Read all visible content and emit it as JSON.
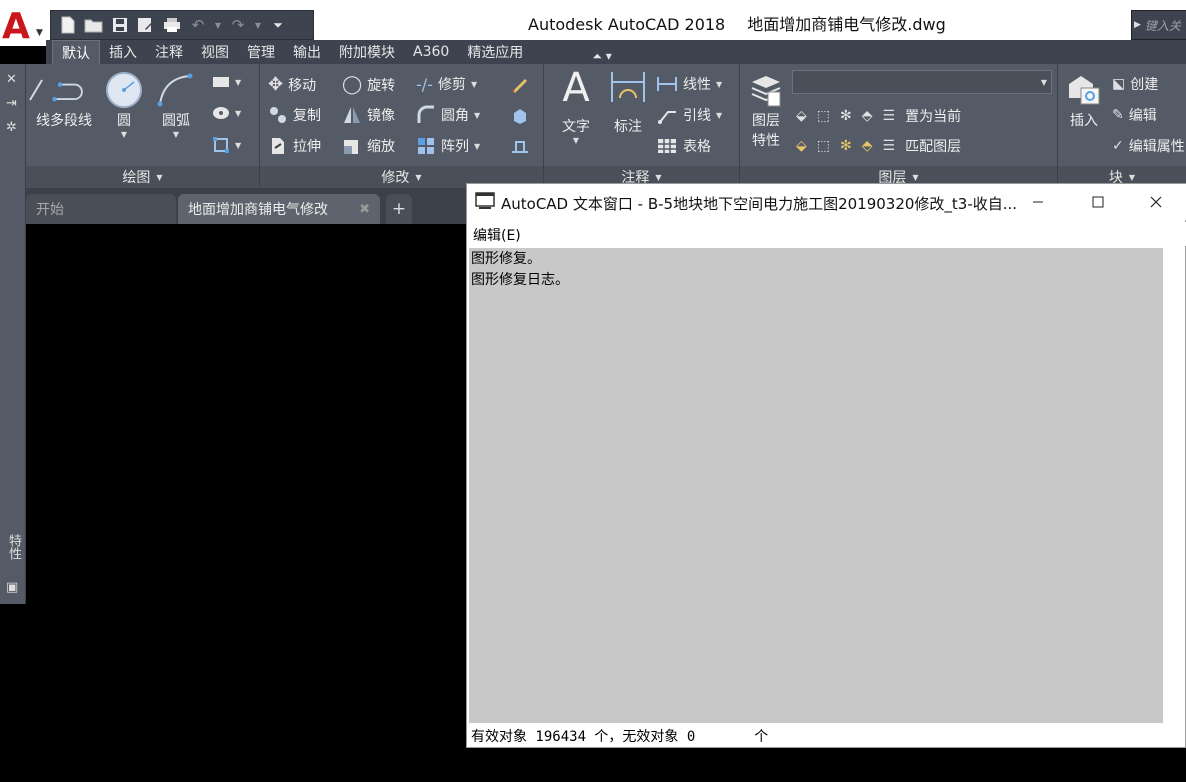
{
  "window": {
    "app_title": "Autodesk AutoCAD 2018",
    "file_title": "地面增加商铺电气修改.dwg",
    "search_placeholder": "键入关"
  },
  "app_button": {
    "logo": "A"
  },
  "quick_access": {
    "icons": [
      "new-icon",
      "open-icon",
      "save-icon",
      "save-as-icon",
      "print-icon",
      "undo-icon",
      "redo-icon",
      "customize-icon"
    ]
  },
  "ribbon_tabs": [
    "默认",
    "插入",
    "注释",
    "视图",
    "管理",
    "输出",
    "附加模块",
    "A360",
    "精选应用"
  ],
  "ribbon": {
    "draw": {
      "label": "绘图",
      "line_partial": "线",
      "polyline": "多段线",
      "circle": "圆",
      "arc": "圆弧"
    },
    "modify": {
      "label": "修改",
      "move": "移动",
      "rotate": "旋转",
      "trim": "修剪",
      "copy": "复制",
      "mirror": "镜像",
      "fillet": "圆角",
      "stretch": "拉伸",
      "scale": "缩放",
      "array": "阵列"
    },
    "annotation": {
      "label": "注释",
      "text": "文字",
      "dimension": "标注",
      "linear": "线性",
      "leader": "引线",
      "table": "表格"
    },
    "layers": {
      "label": "图层",
      "layer_properties_line1": "图层",
      "layer_properties_line2": "特性",
      "set_current": "置为当前",
      "match_layer": "匹配图层",
      "layer_dropdown_value": ""
    },
    "block": {
      "label": "块",
      "insert": "插入",
      "create": "创建",
      "edit": "编辑",
      "edit_attributes": "编辑属性"
    }
  },
  "left_strip": {
    "properties_label": "特性"
  },
  "file_tabs": {
    "start": "开始",
    "drawing": "地面增加商铺电气修改",
    "close_glyph": "✖",
    "add_glyph": "+"
  },
  "text_window": {
    "title": "AutoCAD 文本窗口 - B-5地块地下空间电力施工图20190320修改_t3-收自...",
    "menu_edit": "编辑(E)",
    "history": [
      "图形修复。",
      "图形修复日志。"
    ],
    "command_line": "有效对象 196434 个，无效对象 0       个"
  },
  "colors": {
    "titlebar_bg": "#ffffff",
    "ribbon_bg": "#545b66",
    "tabs_bg": "#3d4450",
    "drawing_bg": "#000000",
    "history_bg": "#c8c8c8",
    "logo_red": "#c8161d"
  }
}
